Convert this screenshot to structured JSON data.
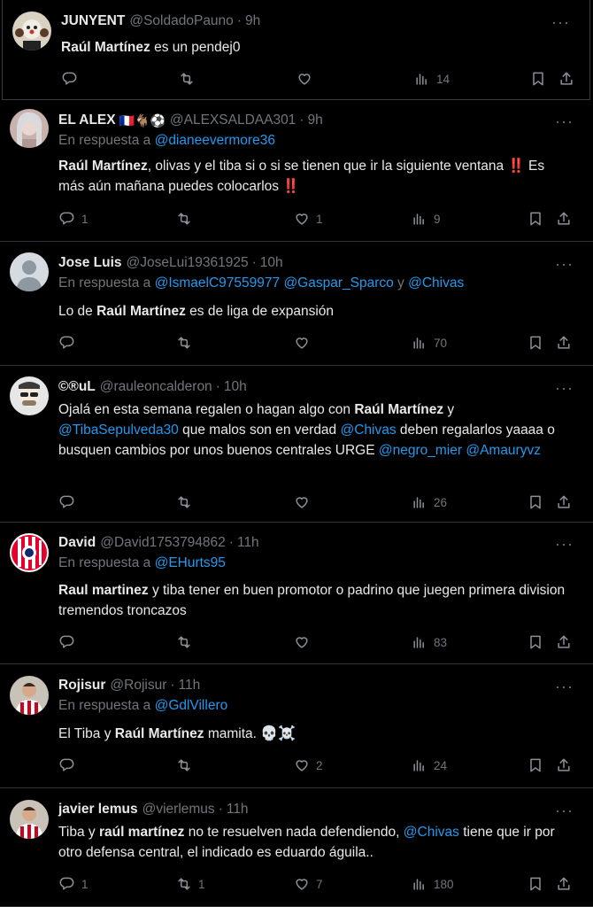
{
  "tweets": [
    {
      "name": "JUNYENT",
      "handle": "@SoldadoPauno",
      "time": "9h",
      "reply_prefix": "",
      "reply_to": [],
      "text": [
        {
          "b": "Raúl Martínez"
        },
        {
          "t": " es un pendej0"
        }
      ],
      "replies": "",
      "retweets": "",
      "likes": "",
      "views": "14",
      "avatar_icon": "clown-avatar-icon"
    },
    {
      "name": "EL ALEX",
      "flags": "🇫🇷🐐⚽",
      "handle": "@ALEXSALDAA301",
      "time": "9h",
      "reply_prefix": "En respuesta a",
      "reply_to": [
        "@dianeevermore36"
      ],
      "text": [
        {
          "b": "Raúl Martínez"
        },
        {
          "t": ", olivas y el tiba si o si se tienen que ir la siguiente ventana ‼️ Es más aún mañana puedes colocarlos ‼️"
        }
      ],
      "replies": "1",
      "retweets": "",
      "likes": "1",
      "views": "9",
      "avatar_icon": "person-avatar-icon"
    },
    {
      "name": "Jose Luis",
      "handle": "@JoseLui19361925",
      "time": "10h",
      "reply_prefix": "En respuesta a",
      "reply_to": [
        "@IsmaelC97559977",
        "@Gaspar_Sparco",
        "y",
        "@Chivas"
      ],
      "text": [
        {
          "t": "Lo de "
        },
        {
          "b": "Raúl Martínez"
        },
        {
          "t": " es de liga de expansión"
        }
      ],
      "replies": "",
      "retweets": "",
      "likes": "",
      "views": "70",
      "avatar_icon": "default-avatar-icon"
    },
    {
      "name": "©®uL",
      "handle": "@rauleoncalderon",
      "time": "10h",
      "reply_prefix": "",
      "reply_to": [],
      "text": [
        {
          "t": "Ojalá en esta semana regalen o hagan algo con "
        },
        {
          "b": "Raúl Martínez"
        },
        {
          "t": " y "
        },
        {
          "m": "@TibaSepulveda30"
        },
        {
          "t": " que malos son en verdad "
        },
        {
          "m": "@Chivas"
        },
        {
          "t": " deben regalarlos yaaaa o busquen cambios por unos buenos centrales URGE "
        },
        {
          "m": "@negro_mier"
        },
        {
          "t": " "
        },
        {
          "m": "@Amauryvz"
        }
      ],
      "replies": "",
      "retweets": "",
      "likes": "",
      "views": "26",
      "avatar_icon": "sunglasses-avatar-icon"
    },
    {
      "name": "David",
      "handle": "@David1753794862",
      "time": "11h",
      "reply_prefix": "En respuesta a",
      "reply_to": [
        "@EHurts95"
      ],
      "text": [
        {
          "b": "Raul martinez"
        },
        {
          "t": " y tiba tener en  buen promotor o padrino que juegen primera division tremendos troncazos"
        }
      ],
      "replies": "",
      "retweets": "",
      "likes": "",
      "views": "83",
      "avatar_icon": "chivas-crest-avatar-icon"
    },
    {
      "name": "Rojisur",
      "handle": "@Rojisur",
      "time": "11h",
      "reply_prefix": "En respuesta a",
      "reply_to": [
        "@GdlVillero"
      ],
      "text": [
        {
          "t": "El Tiba y "
        },
        {
          "b": "Raúl Martínez"
        },
        {
          "t": " mamita. "
        },
        {
          "e": "💀☠️"
        }
      ],
      "replies": "",
      "retweets": "",
      "likes": "2",
      "views": "24",
      "avatar_icon": "player-avatar-icon"
    },
    {
      "name": "javier lemus",
      "handle": "@vierlemus",
      "time": "11h",
      "reply_prefix": "",
      "reply_to": [],
      "text": [
        {
          "t": "Tiba y "
        },
        {
          "b": "raúl martínez"
        },
        {
          "t": " no te resuelven nada defendiendo, "
        },
        {
          "m": "@Chivas"
        },
        {
          "t": " tiene que ir por otro defensa central, el indicado es eduardo águila.."
        }
      ],
      "replies": "1",
      "retweets": "1",
      "likes": "7",
      "views": "180",
      "avatar_icon": "player-avatar-icon"
    }
  ],
  "more_icon": "more-options-icon",
  "actions": {
    "reply_icon": "reply-icon",
    "retweet_icon": "retweet-icon",
    "like_icon": "like-heart-icon",
    "views_icon": "views-chart-icon",
    "bookmark_icon": "bookmark-icon",
    "share_icon": "share-icon"
  },
  "colors": {
    "background": "#000000",
    "text": "#e7e9ea",
    "muted": "#71767b",
    "mention": "#1d9bf0",
    "divider": "#2f3336"
  }
}
